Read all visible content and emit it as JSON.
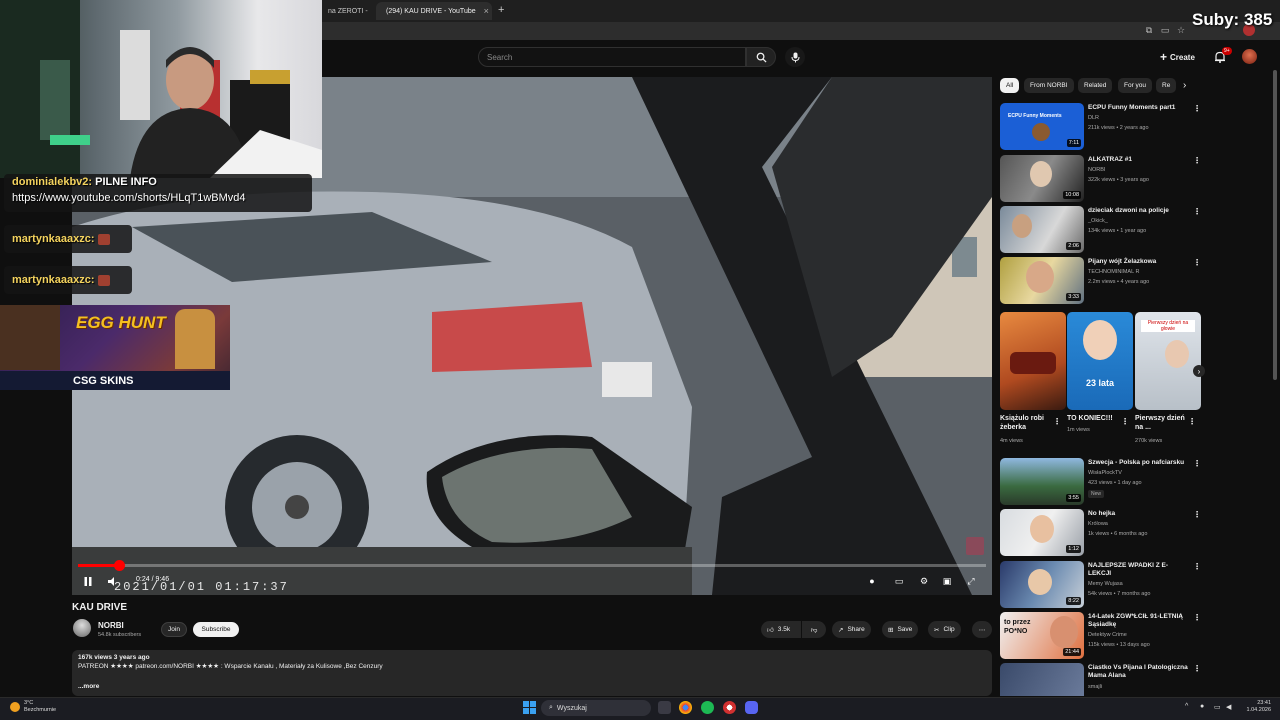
{
  "browser": {
    "tabs": [
      {
        "label": "na ZEROTI - ",
        "active": false
      },
      {
        "label": "(294) KAU DRIVE - YouTube",
        "active": true
      }
    ]
  },
  "stream_overlay": {
    "subs_counter": "Suby: 385",
    "chat": [
      {
        "user": "dominialekbv2:",
        "message": "PILNE INFO"
      },
      {
        "user": "",
        "message": "https://www.youtube.com/shorts/HLqT1wBMvd4"
      },
      {
        "user": "martynkaaaxzc:",
        "message": ""
      },
      {
        "user": "martynkaaaxzc:",
        "message": ""
      }
    ],
    "ad": {
      "title": "EGG HUNT",
      "brand": "CSG SKINS"
    }
  },
  "youtube": {
    "search_placeholder": "Search",
    "create_label": "Create",
    "notifications_badge": "9+",
    "player": {
      "time": "0:24 / 9:46",
      "osd_text": "2021/01/01  01:17:37",
      "progress_fraction": 0.045
    },
    "video": {
      "title": "KAU DRIVE",
      "channel": "NORBI",
      "subscribers": "54.8k subscribers",
      "join_label": "Join",
      "subscribe_label": "Subscribe",
      "likes": "3.5k",
      "share_label": "Share",
      "save_label": "Save",
      "clip_label": "Clip",
      "views_date": "167k views  3 years ago",
      "description": "PATREON ★★★★ patreon.com/NORBI ★★★★ : Wsparcie Kanału , Materiały za Kulisowe ,Bez Cenzury",
      "more_label": "...more"
    },
    "chips": [
      "All",
      "From NORBI",
      "Related",
      "For you",
      "Re"
    ],
    "recommended_top": [
      {
        "title": "ECPU Funny Moments part1",
        "channel": "DLR",
        "meta": "211k views • 2 years ago",
        "duration": "7:11",
        "thumb_text": "ECPU Funny Moments"
      },
      {
        "title": "ALKATRAZ #1",
        "channel": "NORBI",
        "meta": "322k views • 3 years ago",
        "duration": "10:08"
      },
      {
        "title": "dzieciak dzwoni na policje",
        "channel": "_Okick_",
        "meta": "134k views • 1 year ago",
        "duration": "2:06"
      },
      {
        "title": "Pijany wójt Żelazkowa",
        "channel": "TECHNOMINIMAL R",
        "meta": "2.2m views • 4 years ago",
        "duration": "3:33"
      }
    ],
    "shorts": [
      {
        "title": "Książulo robi żeberka",
        "views": "4m views",
        "overlay": ""
      },
      {
        "title": "TO KONIEC!!!",
        "views": "1m views",
        "overlay": "23 lata"
      },
      {
        "title": "Pierwszy dzień na ...",
        "views": "270k views",
        "overlay": "Pierwszy dzień na głowie"
      }
    ],
    "recommended_bottom": [
      {
        "title": "Szwecja - Polska po nafciarsku",
        "channel": "WisłaPlockTV",
        "meta": "423 views • 1 day ago",
        "duration": "3:55",
        "badge": "New"
      },
      {
        "title": "No hejka",
        "channel": "Królowa",
        "meta": "1k views • 6 months ago",
        "duration": "1:12",
        "badge": ""
      },
      {
        "title": "NAJLEPSZE WPADKI Z E-LEKCJI",
        "channel": "Memy Wujasa",
        "meta": "54k views • 7 months ago",
        "duration": "8:22",
        "badge": ""
      },
      {
        "title": "14-Latek ZGW*ŁCIŁ 91-LETNIĄ Sąsiadkę",
        "channel": "Detektyw Crime",
        "meta": "115k views • 13 days ago",
        "duration": "21:44",
        "badge": "",
        "thumb_text": "to przez PO*NO"
      },
      {
        "title": "Ciastko Vs Pijana I Patologiczna Mama Alana",
        "channel": "smajli",
        "meta": "",
        "duration": "",
        "badge": ""
      }
    ]
  },
  "taskbar": {
    "weather_temp": "3°C",
    "weather_desc": "Bezchmurnie",
    "search_label": "Wyszukaj",
    "time": "23:41",
    "date": "1.04.2026"
  },
  "colors": {
    "brand_red": "#ff0000",
    "bg": "#0f0f0f",
    "chip": "#272727"
  }
}
